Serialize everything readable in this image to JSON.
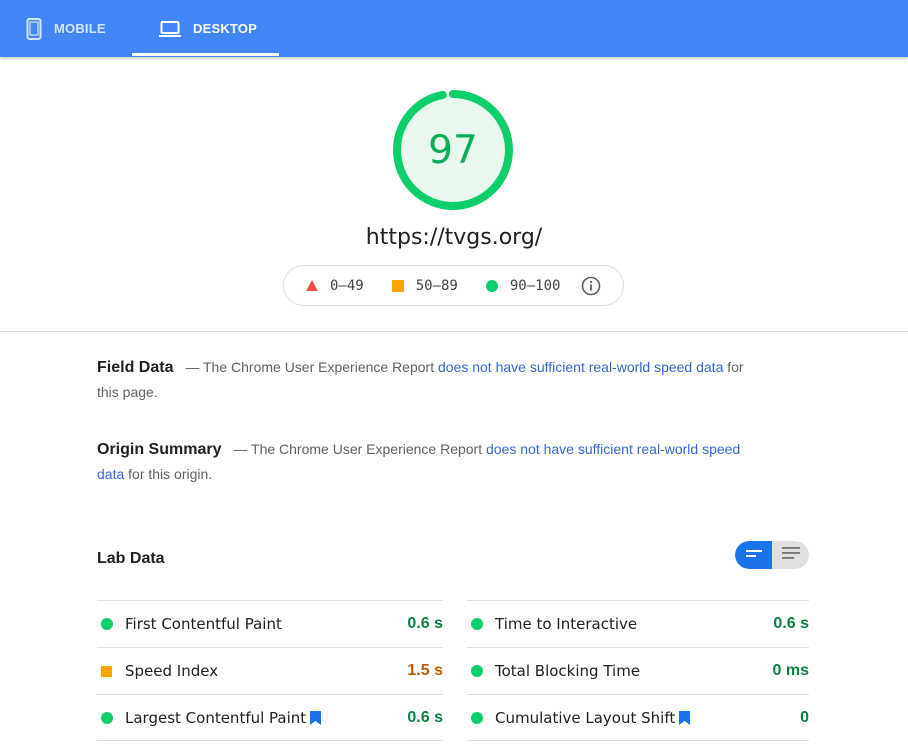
{
  "tabs": [
    {
      "label": "MOBILE",
      "icon": "smartphone-icon",
      "selected": false
    },
    {
      "label": "DESKTOP",
      "icon": "laptop-icon",
      "selected": true
    }
  ],
  "score": {
    "value": "97",
    "fraction": 0.97,
    "color": "#0cce6b"
  },
  "url": "https://tvgs.org/",
  "legend": [
    {
      "shape": "triangle-icon",
      "label": "0–49",
      "color": "#ff4e42"
    },
    {
      "shape": "square-icon",
      "label": "50–89",
      "color": "#ffa400"
    },
    {
      "shape": "circle-icon",
      "label": "90–100",
      "color": "#0cce6b"
    }
  ],
  "field_data": {
    "title": "Field Data",
    "prefix": "— The Chrome User Experience Report",
    "link": "does not have sufficient real-world speed data",
    "suffix": "for this page."
  },
  "origin_summary": {
    "title": "Origin Summary",
    "prefix": "— The Chrome User Experience Report",
    "link": "does not have sufficient real-world speed data",
    "suffix": "for this origin."
  },
  "lab_data": {
    "title": "Lab Data",
    "left": [
      {
        "label": "First Contentful Paint",
        "value": "0.6 s",
        "status": "good",
        "flag": false
      },
      {
        "label": "Speed Index",
        "value": "1.5 s",
        "status": "average",
        "flag": false
      },
      {
        "label": "Largest Contentful Paint",
        "value": "0.6 s",
        "status": "good",
        "flag": true
      }
    ],
    "right": [
      {
        "label": "Time to Interactive",
        "value": "0.6 s",
        "status": "good",
        "flag": false
      },
      {
        "label": "Total Blocking Time",
        "value": "0 ms",
        "status": "good",
        "flag": false
      },
      {
        "label": "Cumulative Layout Shift",
        "value": "0",
        "status": "good",
        "flag": true
      }
    ]
  },
  "colors": {
    "brand": "#4285f4",
    "good": "#0cce6b",
    "average": "#ffa400",
    "link": "#3367d6",
    "flag": "#1a73e8"
  }
}
